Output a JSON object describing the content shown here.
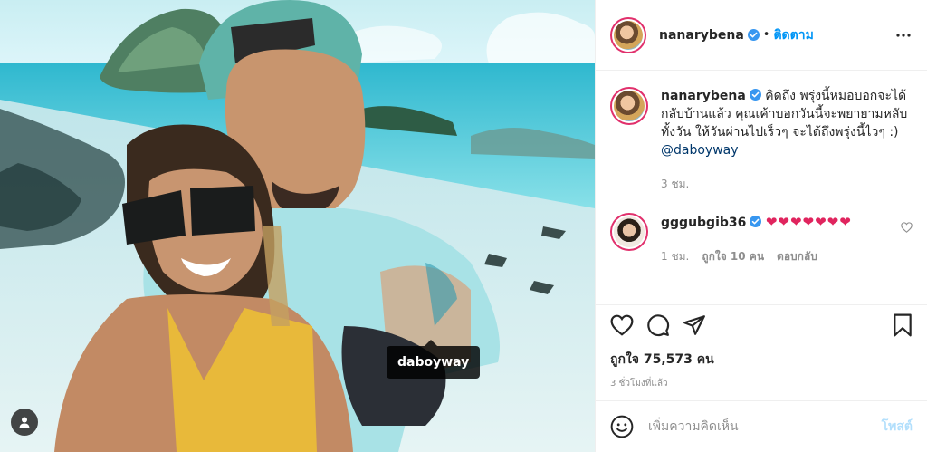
{
  "photo": {
    "tag_label": "daboyway",
    "tags_icon": "user-icon"
  },
  "header": {
    "username": "nanarybena",
    "separator": "•",
    "follow_label": "ติดตาม",
    "more_icon": "more-dots-icon"
  },
  "caption": {
    "username": "nanarybena",
    "text": "คิดถึง พรุ่งนี้หมอบอกจะได้กลับบ้านแล้ว คุณเค้าบอกวันนี้จะพยายามหลับทั้งวัน ให้วันผ่านไปเร็วๆ จะได้ถึงพรุ่งนี้ไวๆ :) ",
    "mention": "@daboyway",
    "time": "3 ชม."
  },
  "comment": {
    "username": "gggubgib36",
    "hearts": "❤❤❤❤❤❤❤",
    "time": "1 ชม.",
    "likes": "ถูกใจ 10 คน",
    "reply_label": "ตอบกลับ"
  },
  "actions": {
    "icons": [
      "heart-icon",
      "comment-icon",
      "share-icon",
      "bookmark-icon"
    ]
  },
  "likes_text": "ถูกใจ 75,573 คน",
  "posted_time": "3 ชั่วโมงที่แล้ว",
  "add_comment": {
    "placeholder": "เพิ่มความคิดเห็น",
    "post_label": "โพสต์"
  },
  "colors": {
    "accent": "#0095f6",
    "verified": "#3897f0",
    "heart": "#e0245e",
    "muted": "#8e8e8e"
  }
}
